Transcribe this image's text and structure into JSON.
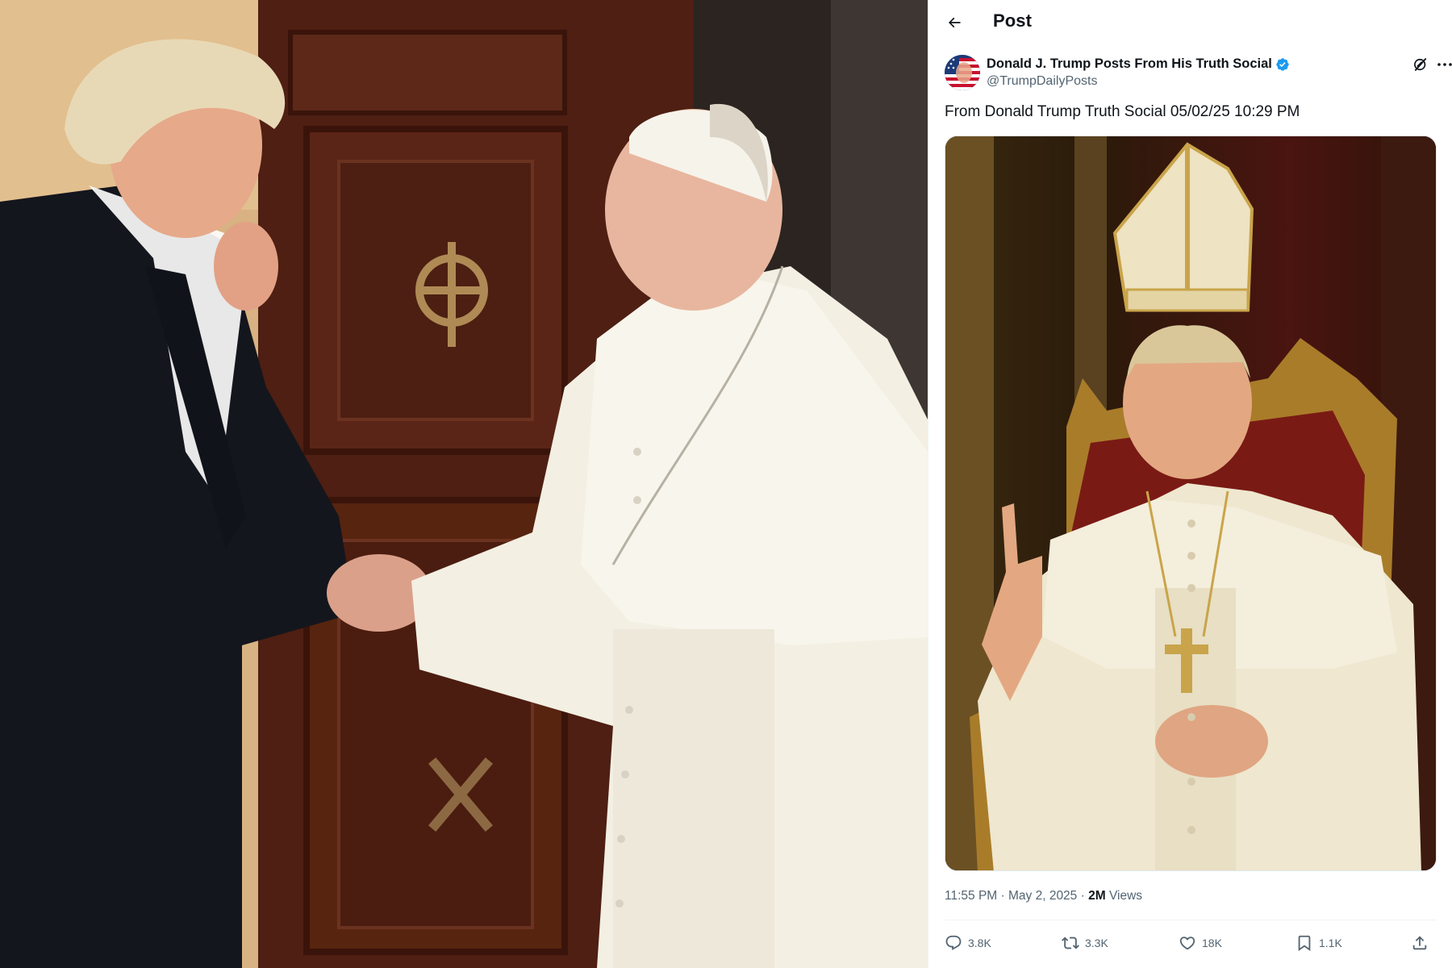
{
  "left_photo": {
    "description_icon": "photo-handshake"
  },
  "header": {
    "back_icon": "arrow-left-icon",
    "title": "Post"
  },
  "author": {
    "name": "Donald J. Trump Posts From His Truth Social",
    "handle": "@TrumpDailyPosts",
    "verified": true,
    "verified_color": "#1d9bf0"
  },
  "post": {
    "text": "From Donald Trump Truth Social 05/02/25 10:29 PM",
    "time": "11:55 PM",
    "separator": "·",
    "date": "May 2, 2025",
    "views_count": "2M",
    "views_label": "Views"
  },
  "actions": {
    "replies": "3.8K",
    "reposts": "3.3K",
    "likes": "18K",
    "bookmarks": "1.1K"
  },
  "colors": {
    "text_primary": "#0f1419",
    "text_secondary": "#536471",
    "divider": "#eff3f4"
  }
}
